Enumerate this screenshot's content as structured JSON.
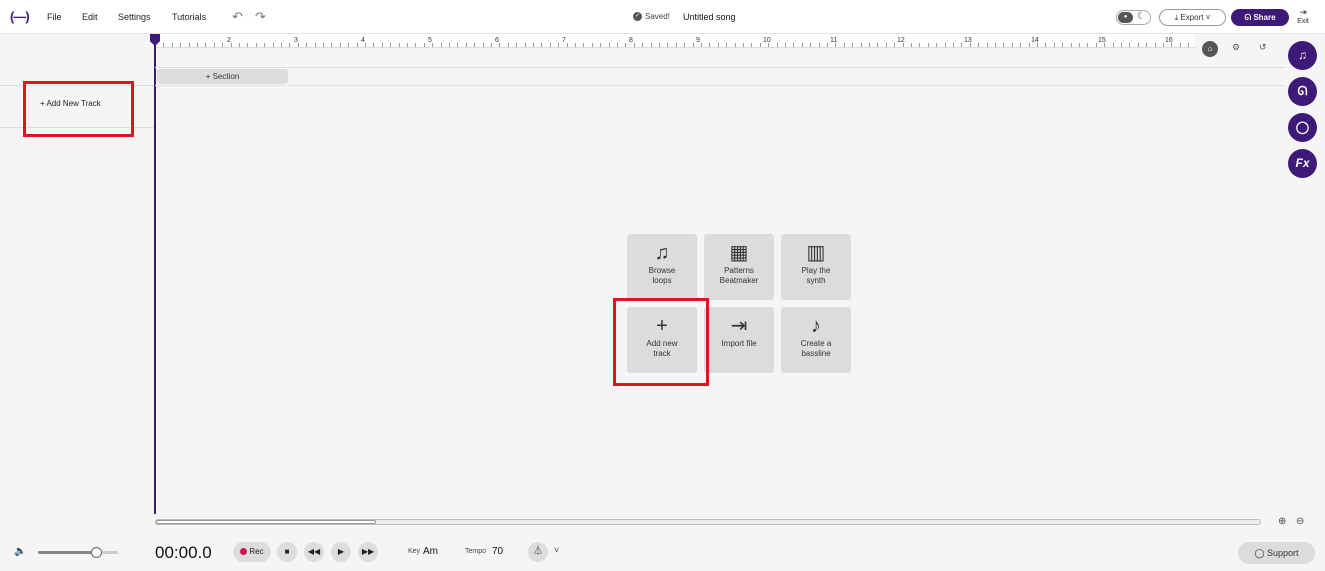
{
  "app": {
    "logo": "(—)",
    "song_title": "Untitled song",
    "saved_status": "Saved!"
  },
  "menu": [
    "File",
    "Edit",
    "Settings",
    "Tutorials"
  ],
  "toolbar": {
    "undo_icon": "undo-icon",
    "redo_icon": "redo-icon",
    "export_label": "Export",
    "share_label": "Share",
    "exit_label": "Exit"
  },
  "timeline": {
    "ruler_numbers": [
      "2",
      "3",
      "4",
      "5",
      "6",
      "7",
      "8",
      "9",
      "10",
      "11",
      "12",
      "13",
      "14",
      "15",
      "16"
    ],
    "section_label": "+ Section",
    "add_track_label": "+ Add New Track"
  },
  "right_sidebar": [
    "music-note-icon",
    "collaborators-icon",
    "chat-icon",
    "fx-icon"
  ],
  "tiles": [
    {
      "icon": "music-note-icon",
      "label_line1": "Browse",
      "label_line2": "loops"
    },
    {
      "icon": "grid-icon",
      "label_line1": "Patterns",
      "label_line2": "Beatmaker"
    },
    {
      "icon": "piano-icon",
      "label_line1": "Play the",
      "label_line2": "synth"
    },
    {
      "icon": "plus-icon",
      "label_line1": "Add new",
      "label_line2": "track"
    },
    {
      "icon": "import-icon",
      "label_line1": "Import file",
      "label_line2": ""
    },
    {
      "icon": "bass-icon",
      "label_line1": "Create a",
      "label_line2": "bassline"
    }
  ],
  "transport": {
    "time": "00:00.0",
    "rec_label": "Rec",
    "key_label": "Key",
    "key_value": "Am",
    "tempo_label": "Tempo",
    "tempo_value": "70",
    "volume_fraction": 0.72,
    "support_label": "Support"
  }
}
